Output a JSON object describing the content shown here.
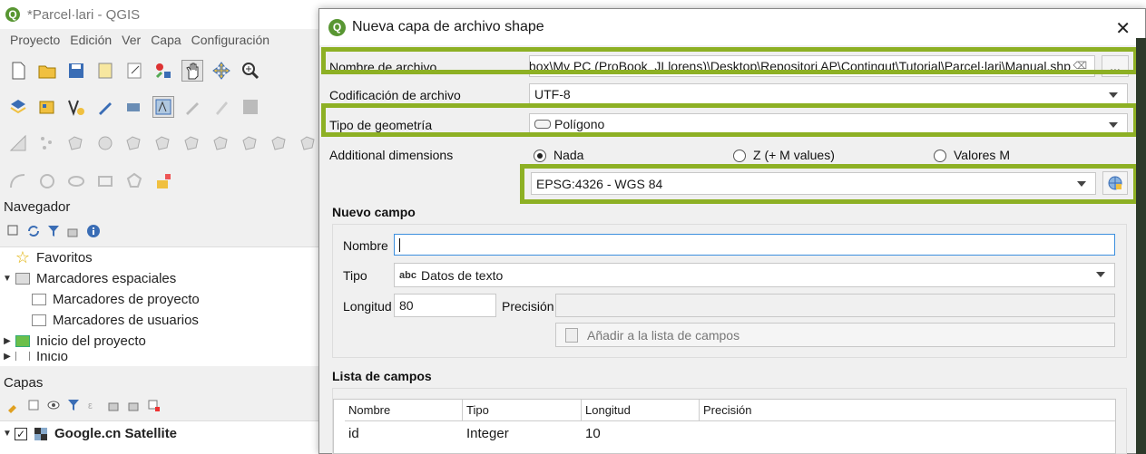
{
  "app": {
    "title": "*Parcel·lari - QGIS",
    "menu": [
      "Proyecto",
      "Edición",
      "Ver",
      "Capa",
      "Configuración"
    ]
  },
  "navigator": {
    "header": "Navegador",
    "items": [
      {
        "label": "Favoritos",
        "icon": "star-icon"
      },
      {
        "label": "Marcadores espaciales",
        "icon": "bookmarks-icon",
        "expanded": true
      },
      {
        "label": "Marcadores de proyecto",
        "icon": "folder-icon"
      },
      {
        "label": "Marcadores de usuarios",
        "icon": "folder-icon"
      },
      {
        "label": "Inicio del proyecto",
        "icon": "project-home-icon"
      },
      {
        "label": "Inicio",
        "icon": "home-icon"
      }
    ]
  },
  "layers": {
    "header": "Capas",
    "items": [
      {
        "label": "Google.cn Satellite",
        "checked": true
      }
    ]
  },
  "dialog": {
    "title": "Nueva capa de archivo shape",
    "filename_label": "Nombre de archivo",
    "filename_value": "Dropbox\\My PC (ProBook_JLlorens)\\Desktop\\Repositori AP\\Contingut\\Tutorial\\Parcel·lari\\Manual.shp",
    "browse_label": "...",
    "encoding_label": "Codificación de archivo",
    "encoding_value": "UTF-8",
    "geometry_label": "Tipo de geometría",
    "geometry_value": "Polígono",
    "dimensions_label": "Additional dimensions",
    "dimensions_options": [
      "Nada",
      "Z (+ M values)",
      "Valores M"
    ],
    "dimensions_selected": "Nada",
    "crs_value": "EPSG:4326 - WGS 84",
    "new_field": {
      "header": "Nuevo campo",
      "name_label": "Nombre",
      "name_value": "",
      "type_label": "Tipo",
      "type_prefix": "abc",
      "type_value": "Datos de texto",
      "length_label": "Longitud",
      "length_value": "80",
      "precision_label": "Precisión",
      "precision_value": "",
      "add_button": "Añadir a la lista de campos"
    },
    "field_list": {
      "header": "Lista de campos",
      "columns": [
        "Nombre",
        "Tipo",
        "Longitud",
        "Precisión"
      ],
      "rows": [
        [
          "id",
          "Integer",
          "10",
          ""
        ]
      ]
    }
  },
  "colors": {
    "highlight": "#8db024",
    "qgis_green": "#589632",
    "focus": "#3c8fde"
  }
}
